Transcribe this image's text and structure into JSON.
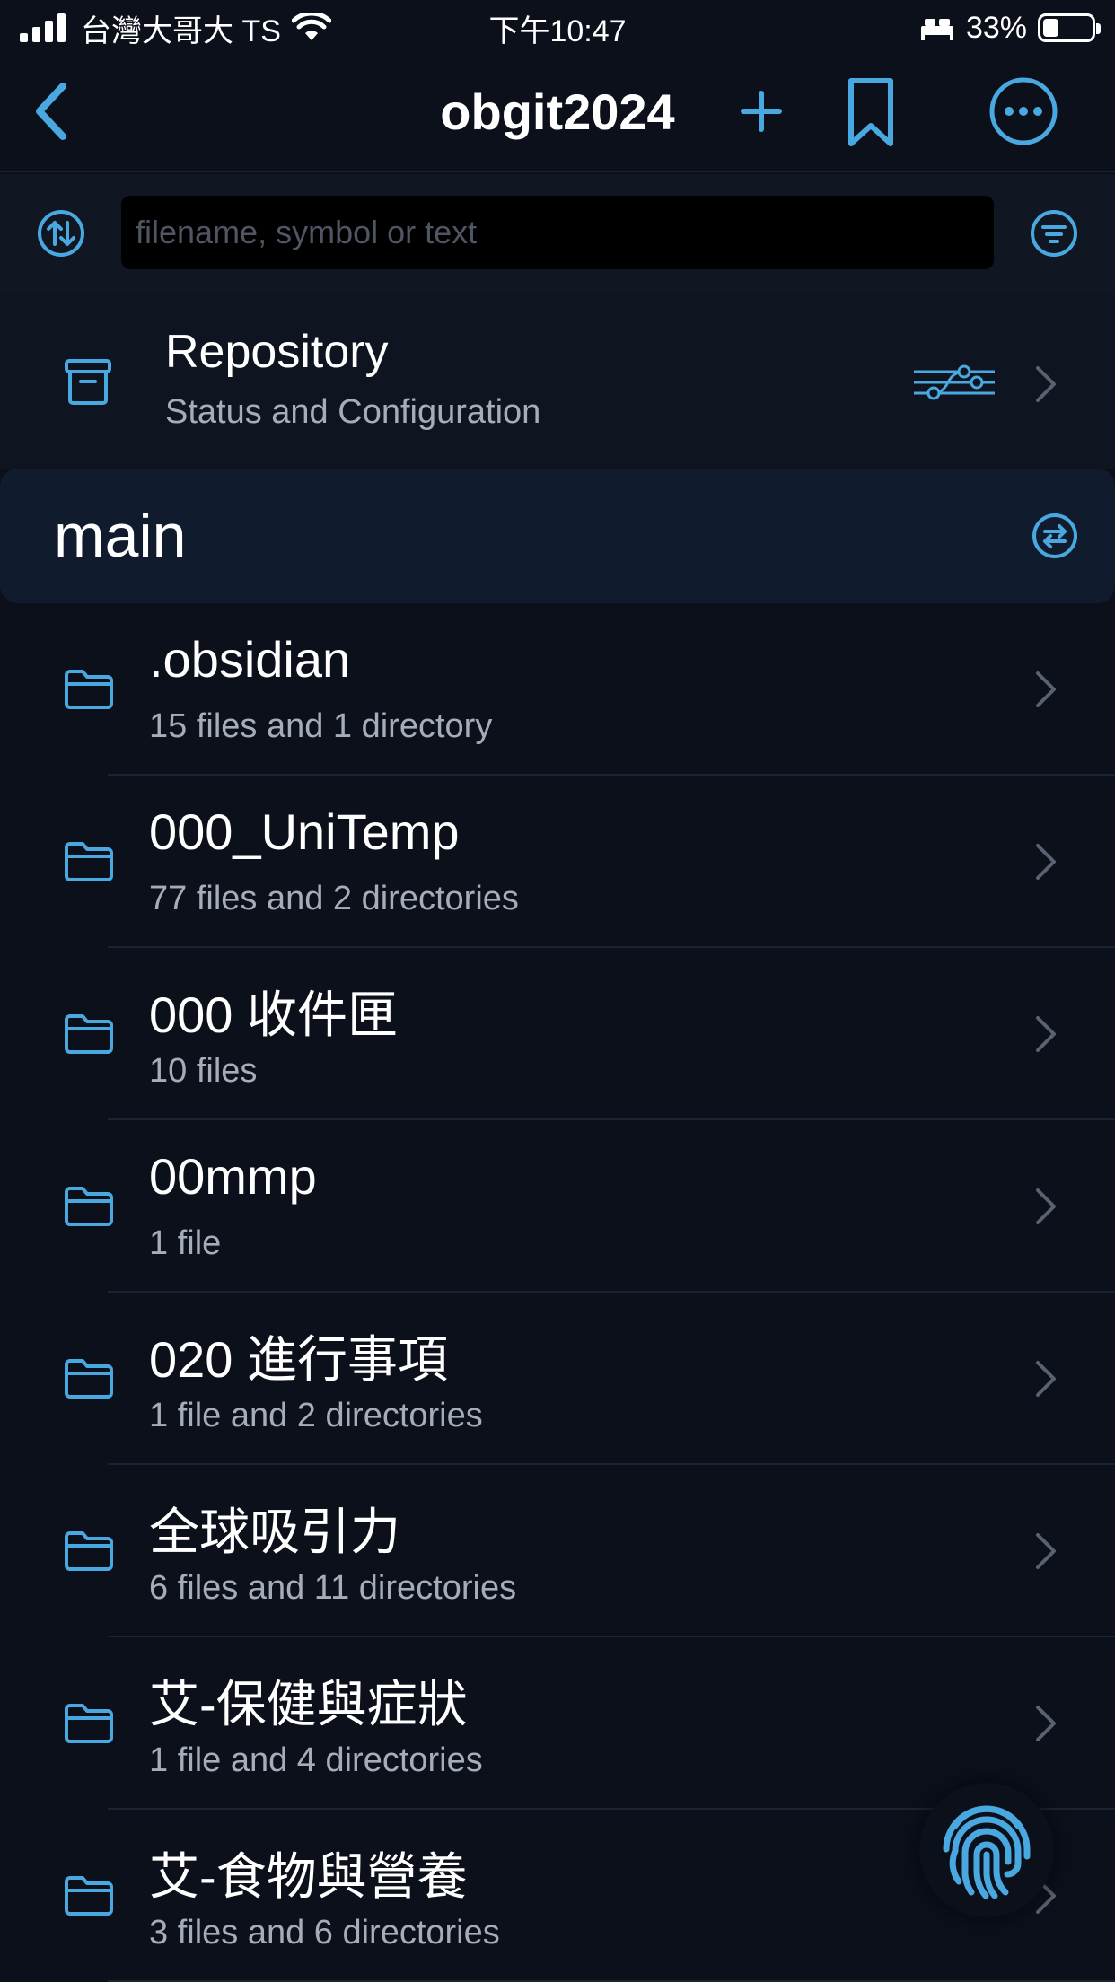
{
  "status_bar": {
    "carrier": "台灣大哥大 TS",
    "time": "下午10:47",
    "battery": "33%",
    "battery_level": 0.33
  },
  "nav": {
    "title": "obgit2024",
    "back_icon": "chevron-left-icon",
    "add_icon": "plus-icon",
    "bookmark_icon": "bookmark-icon",
    "more_icon": "ellipsis-circle-icon"
  },
  "search": {
    "placeholder": "filename, symbol or text",
    "value": ""
  },
  "repository": {
    "title": "Repository",
    "subtitle": "Status and Configuration"
  },
  "branch": {
    "name": "main"
  },
  "folders": [
    {
      "name": ".obsidian",
      "count": "15 files and 1 directory"
    },
    {
      "name": "000_UniTemp",
      "count": "77 files and 2 directories"
    },
    {
      "name": "000 收件匣",
      "count": "10 files"
    },
    {
      "name": "00mmp",
      "count": "1 file"
    },
    {
      "name": "020 進行事項",
      "count": "1 file and 2 directories"
    },
    {
      "name": "全球吸引力",
      "count": "6 files and 11 directories"
    },
    {
      "name": "艾-保健與症狀",
      "count": "1 file and 4 directories"
    },
    {
      "name": "艾-食物與營養",
      "count": "3 files and 6 directories"
    }
  ],
  "colors": {
    "accent": "#4aa8e0",
    "background": "#0b101a",
    "secondary_text": "#a6adb8"
  }
}
